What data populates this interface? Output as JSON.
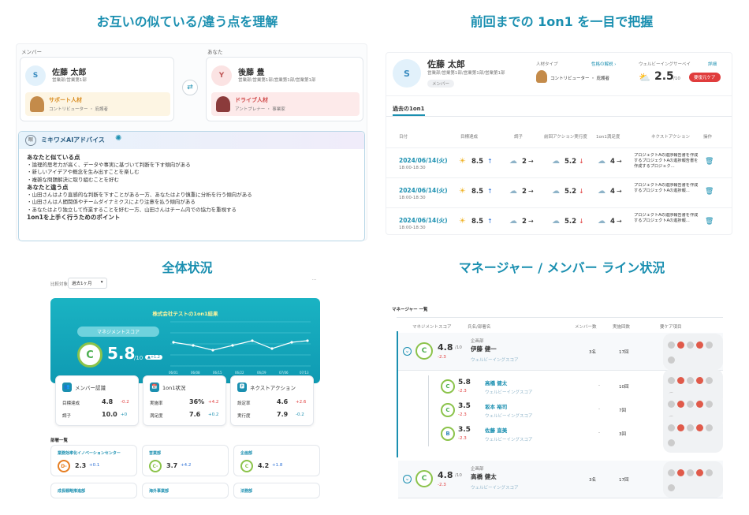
{
  "q1": {
    "title": "お互いの似ている/違う点を理解",
    "member_label": "メンバー",
    "you_label": "あなた",
    "member": {
      "avatar": "S",
      "name": "佐藤 太郎",
      "dept": "営業部/営業第1部",
      "type": "サポート人材",
      "type_sub": "コントリビューター ・ 庇護者"
    },
    "you": {
      "avatar": "Y",
      "name": "後藤 豊",
      "dept": "営業部/営業第1部/営業第1部/営業第1部",
      "type": "ドライブ人材",
      "type_sub": "アントプレナー ・ 事業家"
    },
    "ai_title": "ミキワメAIアドバイス",
    "similar_h": "あなたと似ている点",
    "similar": [
      "論理的思考力が高く、データや事実に基づいて判断を下す傾向がある",
      "新しいアイデアや概念を生み出すことを楽しむ",
      "複雑な問題解決に取り組むことを好む"
    ],
    "diff_h": "あなたと違う点",
    "diff": [
      "山田さんはより直感的な判断を下すことがある一方、あなたはより慎重に分析を行う傾向がある",
      "山田さんは人間関係やチームダイナミクスにより注意を払う傾向がある",
      "あなたはより独立して作業することを好む一方、山田さんはチーム内での協力を重視する"
    ],
    "tips_h": "1on1を上手く行うためのポイント"
  },
  "q2": {
    "title": "前回までの 1on1 を一目で把握",
    "avatar": "S",
    "name": "佐藤 太郎",
    "dept": "営業部/営業第1部/営業第1部/営業第1部",
    "badge": "メンバー",
    "type_label": "人材タイプ",
    "type_link": "性格の解説 ›",
    "type_val": "コントリビューター ・ 庇護者",
    "wb_label": "ウェルビーイングサーベイ",
    "wb_link": "詳細",
    "wb_score": "2.5",
    "wb_den": "/10",
    "care": "要復元ケア",
    "tab": "過去の1on1",
    "cols": [
      "日付",
      "目標達成",
      "調子",
      "前回アクション実行度",
      "1on1満足度",
      "ネクストアクション",
      "操作"
    ],
    "rows": [
      {
        "date": "2024/06/14(火)",
        "time": "18:00-18:30",
        "a": "8.5",
        "b": "2",
        "c": "5.2",
        "d": "4",
        "next": "プロジェクトAの進捗報告書を作成するプロジェクトAの進捗報告書を作成するプロジェク..."
      },
      {
        "date": "2024/06/14(火)",
        "time": "18:00-18:30",
        "a": "8.5",
        "b": "2",
        "c": "5.2",
        "d": "4",
        "next": "プロジェクトAの進捗報告書を作成するプロジェクトAの進捗報..."
      },
      {
        "date": "2024/06/14(火)",
        "time": "18:00-18:30",
        "a": "8.5",
        "b": "2",
        "c": "5.2",
        "d": "4",
        "next": "プロジェクトAの進捗報告書を作成するプロジェクトAの進捗報..."
      }
    ]
  },
  "q3": {
    "title": "全体状況",
    "filter_label": "比較対象",
    "filter_val": "過去1ヶ月",
    "company": "株式会社テストの1on1結果",
    "score_label": "マネジメントスコア",
    "grade": "C",
    "score": "5.8",
    "den": "/10",
    "delta": "▲+1.2",
    "cards": [
      {
        "title": "メンバー認識",
        "r1": "目標達成",
        "v1": "4.8",
        "d1": "-0.2",
        "r2": "調子",
        "v2": "10.0",
        "d2": "+0"
      },
      {
        "title": "1on1状況",
        "r1": "実施率",
        "v1": "36%",
        "d1": "+4.2",
        "r2": "満足度",
        "v2": "7.6",
        "d2": "+0.2"
      },
      {
        "title": "ネクストアクション",
        "r1": "設定率",
        "v1": "4.6",
        "d1": "+2.6",
        "r2": "実行度",
        "v2": "7.9",
        "d2": "-0.2"
      }
    ],
    "dept_h": "部署一覧",
    "depts": [
      {
        "name": "業務効率化イノベーションセンター",
        "grade": "D-",
        "val": "2.3",
        "d": "+0.1"
      },
      {
        "name": "営業部",
        "grade": "C-",
        "val": "3.7",
        "d": "+4.2"
      },
      {
        "name": "企画部",
        "grade": "C",
        "val": "4.2",
        "d": "+1.8"
      },
      {
        "name": "成長戦略推進部",
        "grade": "",
        "val": "",
        "d": ""
      },
      {
        "name": "海外事業部",
        "grade": "",
        "val": "",
        "d": ""
      },
      {
        "name": "法務部",
        "grade": "",
        "val": "",
        "d": ""
      }
    ],
    "xticks": [
      "06/01",
      "06/08",
      "06/15",
      "06/22",
      "06/29",
      "07/06",
      "07/13"
    ]
  },
  "q4": {
    "title": "マネージャー / メンバー ライン状況",
    "list_h": "マネージャー 一覧",
    "cols": [
      "マネジメントスコア",
      "氏名/部署名",
      "メンバー数",
      "実施回数",
      "要ケア項目"
    ],
    "mgrs": [
      {
        "grade": "C",
        "score": "4.8",
        "delta": "-2.3",
        "dept": "企画部",
        "name": "伊藤 健一",
        "wb": "ウェルビーイングスコア",
        "members": "3名",
        "count": "17回"
      },
      {
        "grade": "C",
        "score": "4.8",
        "delta": "-2.3",
        "dept": "企画部",
        "name": "高橋 健太",
        "wb": "ウェルビーイングスコア",
        "members": "3名",
        "count": "17回"
      }
    ],
    "subs": [
      {
        "grade": "C",
        "score": "5.8",
        "delta": "-2.3",
        "name": "高橋 健太",
        "wb": "ウェルビーイングスコア",
        "members": "-",
        "count": "10回"
      },
      {
        "grade": "C",
        "score": "3.5",
        "delta": "-2.3",
        "name": "坂本 裕司",
        "wb": "ウェルビーイングスコア",
        "members": "-",
        "count": "7回"
      },
      {
        "grade": "B",
        "score": "3.5",
        "delta": "-2.3",
        "name": "佐藤 直美",
        "wb": "ウェルビーイングスコア",
        "members": "-",
        "count": "3回"
      }
    ]
  },
  "colors": {
    "teal": "#1a8fb0",
    "cyan": "#14b6c8",
    "red": "#e03c3c",
    "gold": "#e8a33a",
    "green": "#4caf50"
  }
}
